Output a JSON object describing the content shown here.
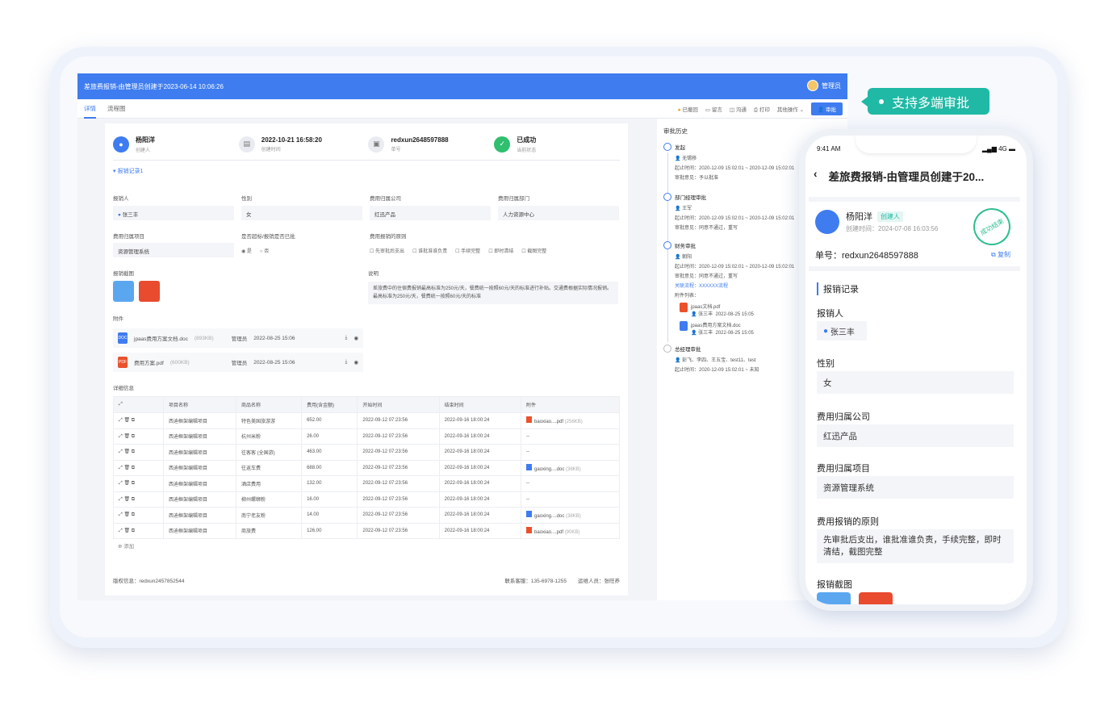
{
  "desktop": {
    "title": "差旅费报销-由管理员创建于2023-06-14 10:06:26",
    "user": "管理员",
    "tabs": [
      "详情",
      "流程图"
    ],
    "actions": [
      "已撤回",
      "留言",
      "沟通",
      "打印",
      "其他操作",
      "审批"
    ],
    "header": {
      "creator": {
        "value": "杨阳洋",
        "label": "创建人"
      },
      "time": {
        "value": "2022-10-21 16:58:20",
        "label": "创建时间"
      },
      "number": {
        "value": "redxun2648597888",
        "label": "单号"
      },
      "status": {
        "value": "已成功",
        "label": "当前状态"
      }
    },
    "section_title": "报销记录1",
    "fields": {
      "reporter": {
        "label": "报销人",
        "value": "张三丰"
      },
      "gender": {
        "label": "性别",
        "value": "女"
      },
      "company": {
        "label": "费用归属公司",
        "value": "红迅产品"
      },
      "dept": {
        "label": "费用归属部门",
        "value": "人力资源中心"
      },
      "project": {
        "label": "费用归属项目",
        "value": "资源管理系统"
      },
      "overrun": {
        "label": "是否超标/报销是否已批",
        "yes": "是",
        "no": "否"
      },
      "principle": {
        "label": "费用报销的原则",
        "options": [
          "先审批后支出",
          "谁批准谁负责",
          "手续完整",
          "即时清结",
          "截图完整"
        ]
      },
      "screenshot_label": "报销截图",
      "desc_label": "说明",
      "desc": "差旅费中的住宿费报销最高标准为250元/天，餐费统一按照60元/天的标准进行补贴。交通费根据实际情况报销。最高标准为250元/天，餐费统一按照60元/天的标准",
      "attachments_label": "附件"
    },
    "attachments": [
      {
        "name": "jpaas费用方案文档.doc",
        "size": "(893KB)",
        "user": "管理员",
        "time": "2022-08-25 15:06",
        "type": "DOC"
      },
      {
        "name": "费用方案.pdf",
        "size": "(600KB)",
        "user": "管理员",
        "time": "2022-08-25 15:06",
        "type": "PDF"
      }
    ],
    "detail_label": "详细信息",
    "table_headers": [
      "项目名称",
      "商品名称",
      "费用(含金额)",
      "开始时间",
      "结束时间",
      "附件"
    ],
    "rows": [
      [
        "西迪框架编辑项目",
        "特色美国旅游游",
        "652.00",
        "2022-09-12 07:23:56",
        "2022-09-16 18:00:24",
        "baoxiao....pdf",
        "(256KB)"
      ],
      [
        "西迪框架编辑项目",
        "杭州米粉",
        "26.00",
        "2022-09-12 07:23:56",
        "2022-09-16 18:00:24",
        "--",
        ""
      ],
      [
        "西迪框架编辑项目",
        "往客客 (全国游)",
        "463.00",
        "2022-09-12 07:23:56",
        "2022-09-16 18:00:24",
        "--",
        ""
      ],
      [
        "西迪框架编辑项目",
        "往返车费",
        "688.00",
        "2022-09-12 07:23:56",
        "2022-09-16 18:00:24",
        "gaoxing....doc",
        "(38KB)"
      ],
      [
        "西迪框架编辑项目",
        "酒店费用",
        "132.00",
        "2022-09-12 07:23:56",
        "2022-09-16 18:00:24",
        "--",
        ""
      ],
      [
        "西迪框架编辑项目",
        "柳州螺蛳粉",
        "16.00",
        "2022-09-12 07:23:56",
        "2022-09-16 18:00:24",
        "--",
        ""
      ],
      [
        "西迪框架编辑项目",
        "南宁老友粉",
        "14.00",
        "2022-09-12 07:23:56",
        "2022-09-16 18:00:24",
        "gaoxing....doc",
        "(38KB)"
      ],
      [
        "西迪框架编辑项目",
        "商旅费",
        "126.00",
        "2022-09-12 07:23:56",
        "2022-09-16 18:00:24",
        "baoxiao....pdf",
        "(90KB)"
      ]
    ],
    "add_label": "添加",
    "footer": {
      "left": "版权信息：redxun2457852544",
      "contact": "联系客服：135-6978-1255",
      "manager": "运维人员：张旺养"
    },
    "history": {
      "title": "审批历史",
      "nodes": [
        {
          "name": "发起",
          "user": "无锡移",
          "lines": [
            "起止时间：2020-12-09 15:02:01 ~ 2020-12-09 15:02:01",
            "审批意见：予以批准"
          ]
        },
        {
          "name": "部门经理审批",
          "user": "王军",
          "lines": [
            "起止时间：2020-12-09 15:02:01 ~ 2020-12-09 15:02:01",
            "审批意见：同意不通过，重写"
          ]
        },
        {
          "name": "财务审批",
          "user": "朝阳",
          "lines": [
            "起止时间：2020-12-09 15:02:01 ~ 2020-12-09 15:02:01",
            "审批意见：同意不通过，重写",
            "关联流程：XXXXXX流程",
            "附件列表："
          ]
        },
        {
          "name": "总经理审批",
          "user": "彭飞、李四、王五宝、test11、test",
          "lines": [
            "起止时间：2020-12-09 15:02:01 ~ 未知"
          ]
        }
      ],
      "files": [
        {
          "name": "jpaas文档.pdf",
          "user": "张三丰",
          "time": "2022-08-25 15:05"
        },
        {
          "name": "jpaas费用方案文档.doc",
          "user": "张三丰",
          "time": "2022-08-25 15:05"
        }
      ]
    }
  },
  "badge": "支持多端审批",
  "mobile": {
    "time": "9:41 AM",
    "signal": "4G",
    "title": "差旅费报销-由管理员创建于20...",
    "name": "杨阳洋",
    "tag": "创建人",
    "created": "创建时间：2024-07-08 16:03:56",
    "stamp": "成功结束",
    "order": "单号：redxun2648597888",
    "copy": "复制",
    "section": "报销记录",
    "reporter_label": "报销人",
    "reporter": "张三丰",
    "gender_label": "性别",
    "gender": "女",
    "company_label": "费用归属公司",
    "company": "红迅产品",
    "project_label": "费用归属项目",
    "project": "资源管理系统",
    "principle_label": "费用报销的原则",
    "principle": "先审批后支出，谁批准谁负责，手续完整，即时清结，截图完整",
    "screenshot_label": "报销截图"
  }
}
